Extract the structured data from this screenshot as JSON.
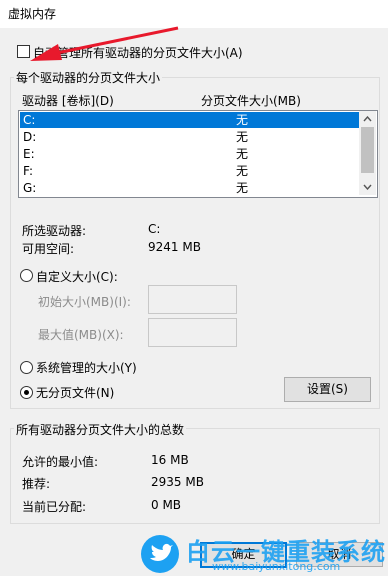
{
  "window": {
    "title": "虚拟内存"
  },
  "auto_manage": {
    "label": "自动管理所有驱动器的分页文件大小(A)",
    "checked": false
  },
  "per_drive": {
    "group_label": "每个驱动器的分页文件大小",
    "columns": [
      "驱动器 [卷标](D)",
      "分页文件大小(MB)"
    ],
    "rows": [
      {
        "drive": "C:",
        "size": "无"
      },
      {
        "drive": "D:",
        "size": "无"
      },
      {
        "drive": "E:",
        "size": "无"
      },
      {
        "drive": "F:",
        "size": "无"
      },
      {
        "drive": "G:",
        "size": "无"
      }
    ],
    "selected_drive_label": "所选驱动器:",
    "selected_drive_value": "C:",
    "free_space_label": "可用空间:",
    "free_space_value": "9241 MB",
    "custom_size_label": "自定义大小(C):",
    "initial_size_label": "初始大小(MB)(I):",
    "max_size_label": "最大值(MB)(X):",
    "system_managed_label": "系统管理的大小(Y)",
    "no_paging_label": "无分页文件(N)",
    "set_button": "设置(S)"
  },
  "totals": {
    "group_label": "所有驱动器分页文件大小的总数",
    "min_label": "允许的最小值:",
    "min_value": "16 MB",
    "recommended_label": "推荐:",
    "recommended_value": "2935 MB",
    "allocated_label": "当前已分配:",
    "allocated_value": "0 MB"
  },
  "buttons": {
    "ok": "确定",
    "cancel": "取消"
  },
  "watermark": {
    "brand": "白云一键重装系统",
    "url": "www.baiyunxitong.com"
  },
  "colors": {
    "selection": "#0078d7",
    "arrow": "#e8192c",
    "watermark": "#1da1f2"
  }
}
